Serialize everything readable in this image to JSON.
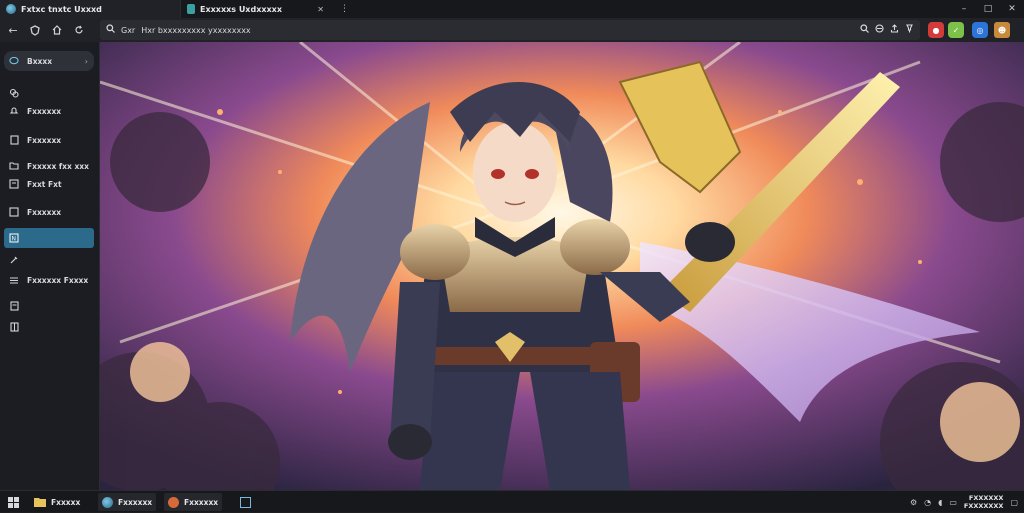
{
  "window": {
    "tabs": [
      {
        "label": "Fxtxc tnxtc Uxxxd"
      },
      {
        "label": "Exxxxxs Uxdxxxxx"
      }
    ],
    "controls": {
      "minimize": "–",
      "maximize": "□",
      "close": "✕",
      "more": "⋮",
      "new_tab": "✕"
    }
  },
  "toolbar": {
    "back": "←",
    "address_text": "Hxr bxxxxxxxxx yxxxxxxxx",
    "address_prefix": "Gxr",
    "icons": [
      "search-icon",
      "translate-icon",
      "share-icon",
      "pin-icon"
    ]
  },
  "sidebar": {
    "items": [
      {
        "label": "Bxxxx",
        "icon": "chat-icon"
      },
      {
        "label": "",
        "icon": "link-icon"
      },
      {
        "label": "Fxxxxxx",
        "icon": "bell-icon"
      },
      {
        "label": "Fxxxxxx",
        "icon": "doc-icon"
      },
      {
        "label": "Fxxxxx fxx xxx",
        "icon": "folder-icon"
      },
      {
        "label": "Fxxt Fxt",
        "icon": "note-icon"
      },
      {
        "label": "Fxxxxxx",
        "icon": "box-icon"
      },
      {
        "label": "",
        "icon": "active-icon"
      },
      {
        "label": "",
        "icon": "tools-icon"
      },
      {
        "label": "Fxxxxxx Fxxxx",
        "icon": "list-icon"
      },
      {
        "label": "",
        "icon": "doc2-icon"
      },
      {
        "label": "",
        "icon": "grid-icon"
      }
    ]
  },
  "taskbar": {
    "items": [
      {
        "label": "Fxxxxx"
      },
      {
        "label": "Fxxxxxx"
      },
      {
        "label": "Fxxxxxx"
      }
    ],
    "clock_time": "FXXXXXX",
    "clock_date": "FXXXXXXX"
  },
  "colors": {
    "accent": "#2b6a8a",
    "ext_red": "#d33a3a",
    "ext_green": "#7cc24a",
    "ext_blue": "#2c74d8"
  }
}
